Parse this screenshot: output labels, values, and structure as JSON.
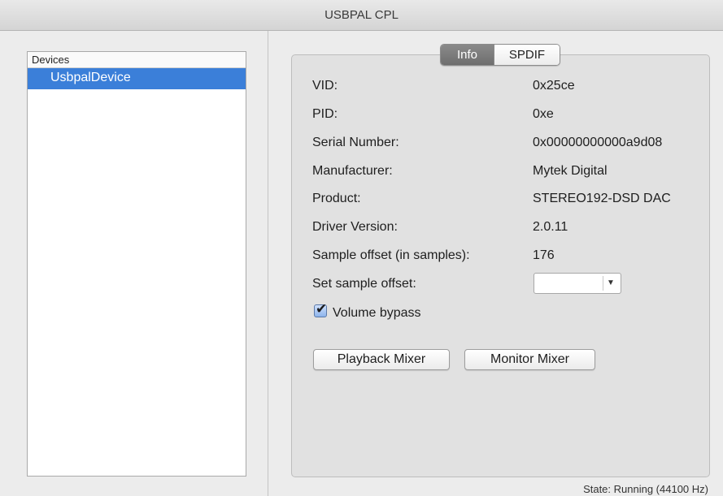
{
  "window": {
    "title": "USBPAL CPL"
  },
  "devices": {
    "header": "Devices",
    "items": [
      "UsbpalDevice"
    ]
  },
  "tabs": [
    {
      "label": "Info",
      "active": true
    },
    {
      "label": "SPDIF",
      "active": false
    }
  ],
  "info": [
    {
      "label": "VID:",
      "value": "0x25ce"
    },
    {
      "label": "PID:",
      "value": "0xe"
    },
    {
      "label": "Serial Number:",
      "value": "0x00000000000a9d08"
    },
    {
      "label": "Manufacturer:",
      "value": "Mytek Digital"
    },
    {
      "label": "Product:",
      "value": "STEREO192-DSD DAC"
    },
    {
      "label": "Driver Version:",
      "value": "2.0.11"
    },
    {
      "label": "Sample offset (in samples):",
      "value": "176"
    }
  ],
  "set_offset": {
    "label": "Set sample offset:",
    "value": ""
  },
  "volume_bypass": {
    "label": "Volume bypass",
    "checked": true
  },
  "buttons": {
    "playback": "Playback Mixer",
    "monitor": "Monitor Mixer"
  },
  "status": "State: Running (44100 Hz)",
  "colors": {
    "selection": "#3b7fd9",
    "panel": "#e1e1e1",
    "window": "#ececec"
  },
  "icons": {
    "dropdown": "chevron-down-icon",
    "check": "checkmark-icon"
  }
}
